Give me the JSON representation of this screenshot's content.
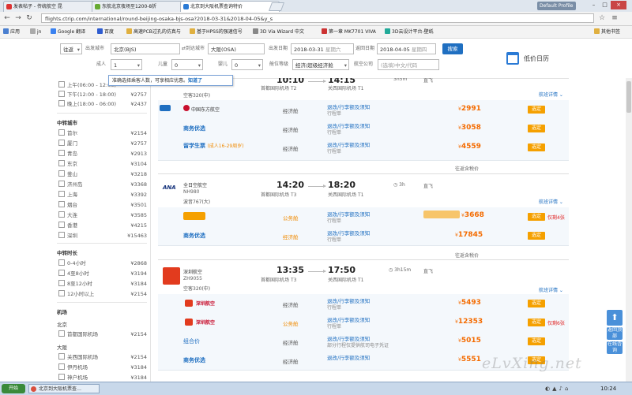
{
  "browser": {
    "tabs": [
      {
        "title": "发表帖子 - 传统航空 昆"
      },
      {
        "title": "东航北京夜场至1200-8折"
      },
      {
        "title": "北京到大阪机票查询特价"
      }
    ],
    "user_badge": "Default Profile",
    "url": "flights.ctrip.com/international/round-beijing-osaka-bjs-osa?2018-03-31&2018-04-05&y_s",
    "bookmarks": [
      "应用",
      "jn",
      "Google 翻译",
      "百度",
      "高速PCB过孔的仿真与",
      "基于HPSS的强速信号",
      "3D Via Wizard 中文",
      "第一章 MK7701 VIVA",
      "3D云设计平台-壁纸",
      "其他书签"
    ]
  },
  "search": {
    "trip_type": "往返",
    "from_label": "出发城市",
    "from_value": "北京(BJS)",
    "to_label": "到达城市",
    "to_value": "大阪(OSA)",
    "depart_label": "出发日期",
    "depart_date": "2018-03-31",
    "depart_week": "星期六",
    "return_label": "返回日期",
    "return_date": "2018-04-05",
    "return_week": "星期四",
    "adult_label": "成人",
    "adult_value": "1",
    "child_label": "儿童",
    "child_value": "0",
    "infant_label": "婴儿",
    "infant_value": "0",
    "class_label": "舱位等级",
    "class_value": "经济/超级经济舱",
    "airline_label": "航空公司",
    "airline_placeholder": "(选填)中文/代码",
    "search_button": "搜索",
    "calendar_label": "低价日历",
    "tooltip_text": "准确选择乘客人数，可享相应优惠。",
    "tooltip_link": "知道了"
  },
  "filters": {
    "time_items": [
      {
        "label": "上午(06:00 - 12:00)",
        "price": ""
      },
      {
        "label": "下午(12:00 - 18:00)",
        "price": "¥2757"
      },
      {
        "label": "晚上(18:00 - 06:00)",
        "price": "¥2437"
      }
    ],
    "transfer_title": "中转城市",
    "cities": [
      {
        "label": "首尔",
        "price": "¥2154"
      },
      {
        "label": "厦门",
        "price": "¥2757"
      },
      {
        "label": "青岛",
        "price": "¥2913"
      },
      {
        "label": "东京",
        "price": "¥3104"
      },
      {
        "label": "釜山",
        "price": "¥3218"
      },
      {
        "label": "济州岛",
        "price": "¥3368"
      },
      {
        "label": "上海",
        "price": "¥3392"
      },
      {
        "label": "烟台",
        "price": "¥3501"
      },
      {
        "label": "大连",
        "price": "¥3585"
      },
      {
        "label": "香港",
        "price": "¥4215"
      },
      {
        "label": "深圳",
        "price": "¥15463"
      }
    ],
    "duration_title": "中转时长",
    "durations": [
      {
        "label": "0-4小时",
        "price": "¥2868"
      },
      {
        "label": "4至8小时",
        "price": "¥3194"
      },
      {
        "label": "8至12小时",
        "price": "¥3184"
      },
      {
        "label": "12小时以上",
        "price": "¥2154"
      }
    ],
    "airport_title": "机场",
    "beijing_title": "北京",
    "beijing_airports": [
      {
        "label": "首都国际机场",
        "price": "¥2154"
      }
    ],
    "osaka_title": "大阪",
    "osaka_airports": [
      {
        "label": "关西国际机场",
        "price": "¥2154"
      },
      {
        "label": "伊丹机场",
        "price": "¥3184"
      },
      {
        "label": "神户机场",
        "price": "¥3184"
      }
    ]
  },
  "flights": [
    {
      "dep_time": "10:10",
      "dep_airport": "首都国际机场",
      "dep_terminal": "T2",
      "arr_time": "14:15",
      "arr_airport": "关西国际机场",
      "arr_terminal": "T1",
      "duration": "3h5m",
      "meal": "直飞",
      "aircraft": "空客320(中)",
      "detail_link": "航班详情",
      "offers": [
        {
          "product": "中国东方航空",
          "seat": "经济舱",
          "svc": "退改/行李额及须知",
          "svc_sub": "行程单",
          "price": "2991"
        },
        {
          "product": "商务优选",
          "seat": "经济舱",
          "svc": "退改/行李额及须知",
          "svc_sub": "行程单",
          "price": "3058"
        },
        {
          "product": "留学生票",
          "product_note": "(成人16-29周岁)",
          "seat": "经济舱",
          "svc": "退改/行李额及须知",
          "svc_sub": "行程单",
          "price": "4559"
        }
      ],
      "tax_note": "往返含税价"
    },
    {
      "airline": "全日空航空",
      "flight_no": "NH980",
      "aircraft": "波音767(大)",
      "dep_time": "14:20",
      "dep_airport": "首都国际机场",
      "dep_terminal": "T3",
      "arr_time": "18:20",
      "arr_airport": "关西国际机场",
      "arr_terminal": "T1",
      "duration": "3h",
      "meal": "直飞",
      "detail_link": "航班详情",
      "offers": [
        {
          "product": "",
          "seat": "公务舱",
          "svc": "退改/行李额及须知",
          "svc_sub": "行程单",
          "price": "3668",
          "badge": "仅剩4张"
        },
        {
          "product": "商务优选",
          "seat": "经济舱",
          "svc": "退改/行李额及须知",
          "svc_sub": "行程单",
          "price": "17845"
        }
      ],
      "tax_note": "往返含税价"
    },
    {
      "airline": "深圳航空",
      "flight_no": "ZH9055",
      "aircraft": "空客320(中)",
      "dep_time": "13:35",
      "dep_airport": "首都国际机场",
      "dep_terminal": "T3",
      "arr_time": "17:50",
      "arr_airport": "关西国际机场",
      "arr_terminal": "T1",
      "duration": "3h15m",
      "meal": "直飞",
      "detail_link": "航班详情",
      "offers": [
        {
          "product": "深圳航空",
          "seat": "经济舱",
          "svc": "退改/行李额及须知",
          "svc_sub": "行程单",
          "price": "5493"
        },
        {
          "product": "深圳航空",
          "seat": "公务舱",
          "svc": "退改/行李额及须知",
          "svc_sub": "行程单",
          "price": "12353",
          "badge": "仅剩6张"
        },
        {
          "product": "组合价",
          "seat": "经济舱",
          "svc": "退改/行李额及须知",
          "svc_sub": "部分行程仅提供航司电子凭证",
          "price": "5015"
        },
        {
          "product": "商务优选",
          "seat": "经济舱",
          "svc": "退改/行李额及须知",
          "svc_sub": "",
          "price": "5551"
        }
      ]
    }
  ],
  "booking_label": "选定",
  "side_tools": [
    "返回顶部",
    "在线咨询"
  ],
  "taskbar": {
    "start": "开始",
    "app": "北京到大阪机票查…",
    "time": "10:24"
  },
  "watermark": "eLvXing.net",
  "colors": {
    "accent": "#1f6fc1",
    "price": "#f46b00",
    "book": "#f5a000",
    "warn": "#e02020"
  }
}
